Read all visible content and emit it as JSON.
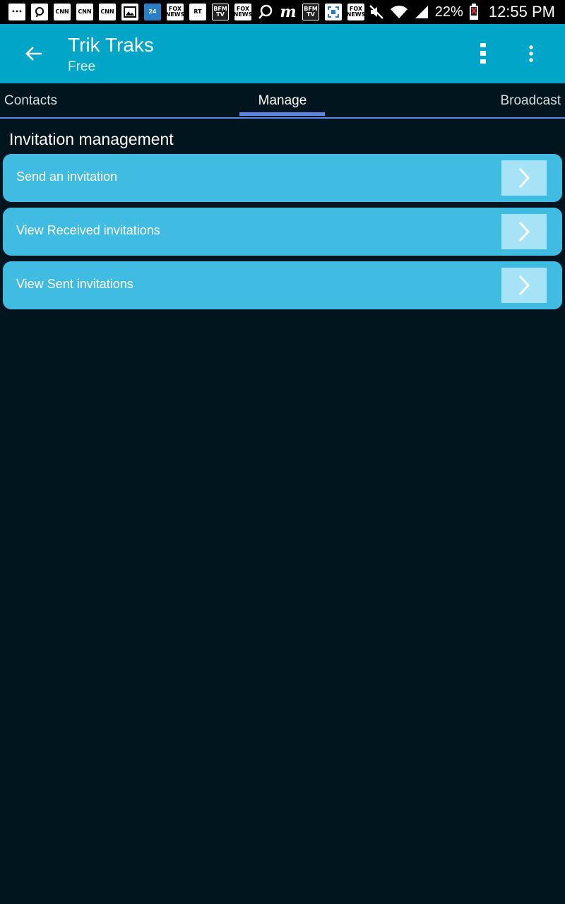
{
  "status_bar": {
    "battery_percent": "22%",
    "time": "12:55 PM",
    "notification_icons": [
      "dots-icon",
      "chat-icon",
      "cnn-icon",
      "cnn-icon",
      "cnn-icon",
      "image-icon",
      "france24-icon",
      "foxnews-icon",
      "rt-icon",
      "bfmtv-icon",
      "foxnews-icon",
      "search-icon",
      "m-icon",
      "bfmtv-icon",
      "frame-icon",
      "foxnews-icon"
    ],
    "notif_labels": {
      "cnn": "CNN",
      "rt": "RT",
      "bfm": "BFM TV",
      "fox": "FOX NEWS",
      "f24": "24",
      "m": "m"
    }
  },
  "app_bar": {
    "title": "Trik Traks",
    "subtitle": "Free",
    "color": "#00a5c8"
  },
  "tabs": [
    {
      "label": "Contacts",
      "selected": false
    },
    {
      "label": "Manage",
      "selected": true
    },
    {
      "label": "Broadcast",
      "selected": false
    }
  ],
  "section": {
    "title": "Invitation management",
    "items": [
      {
        "label": "Send an invitation"
      },
      {
        "label": "View Received invitations"
      },
      {
        "label": "View Sent invitations"
      }
    ]
  },
  "colors": {
    "background": "#01151e",
    "row": "#40bce3",
    "row_arrow_bg": "#a7e3f6",
    "tab_indicator": "#5b87e6"
  }
}
